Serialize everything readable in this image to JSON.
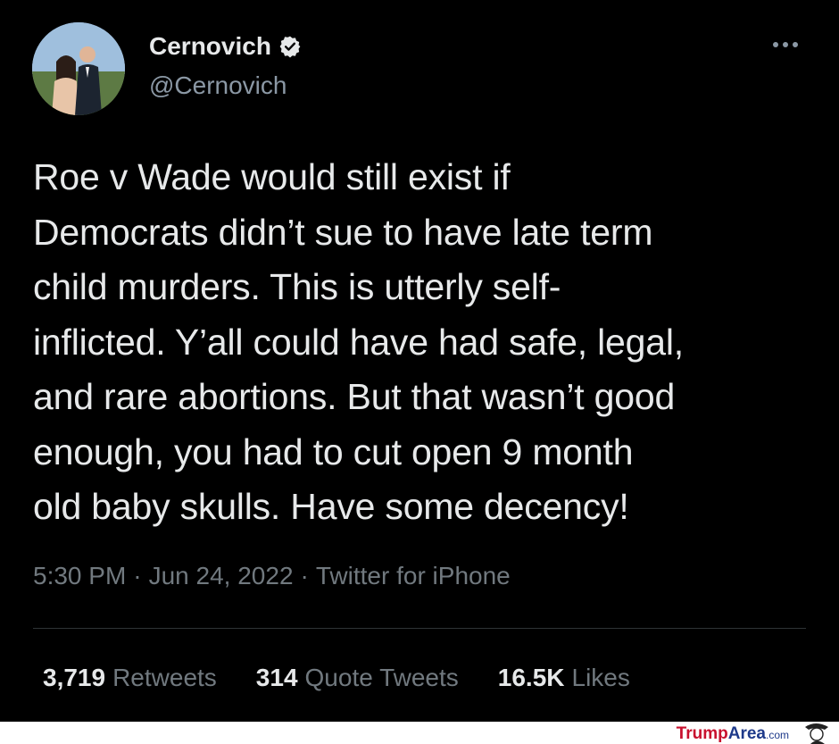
{
  "tweet": {
    "display_name": "Cernovich",
    "handle": "@Cernovich",
    "text": "Roe v Wade would still exist if\nDemocrats didn’t sue to have late term\nchild murders. This is utterly self-\ninflicted. Y’all could have had safe, legal,\nand rare abortions. But that wasn’t good\nenough, you had to cut open 9 month\nold baby skulls. Have some decency!",
    "time": "5:30 PM",
    "date": "Jun 24, 2022",
    "source": "Twitter for iPhone",
    "separator": "·",
    "stats": {
      "retweets_count": "3,719",
      "retweets_label": "Retweets",
      "quotes_count": "314",
      "quotes_label": "Quote Tweets",
      "likes_count": "16.5K",
      "likes_label": "Likes"
    }
  },
  "icons": {
    "verified": "verified-badge-icon",
    "more": "more-options-icon"
  },
  "watermark": {
    "part1": "Trump",
    "part2": "Area",
    "part3": ".com"
  },
  "colors": {
    "background": "#000000",
    "text": "#e7e9ea",
    "secondary_text": "#71797f",
    "divider": "#2f3336",
    "watermark_red": "#c8102e",
    "watermark_blue": "#1e3a8a"
  }
}
